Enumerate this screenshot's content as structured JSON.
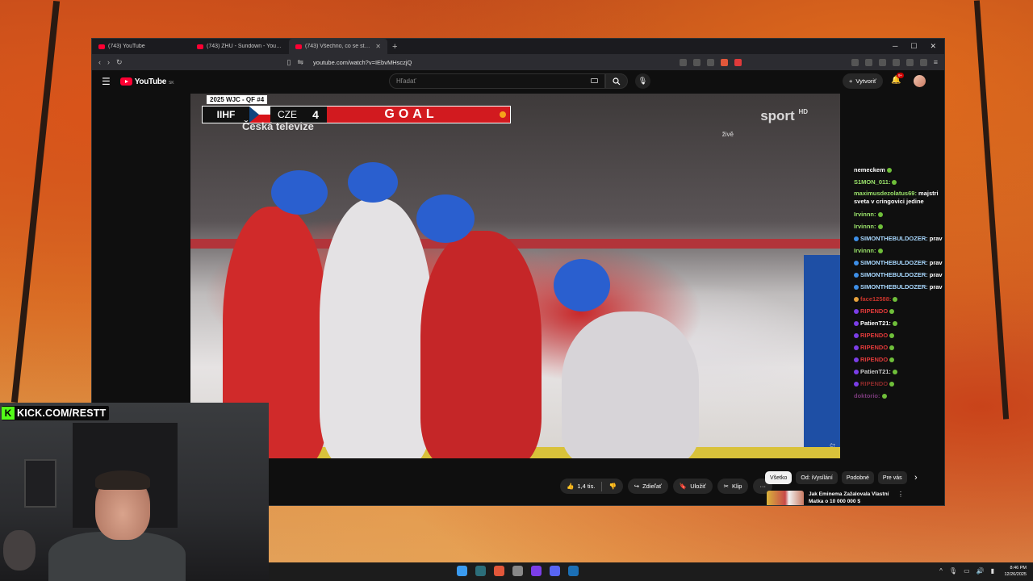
{
  "browser": {
    "tabs": [
      {
        "label": "(743) YouTube",
        "active": false
      },
      {
        "label": "(743) ZHU - Sundown - YouTube",
        "active": false
      },
      {
        "label": "(743) Všechno, co se stalo v …",
        "active": true
      }
    ],
    "new_tab": "+",
    "url": "youtube.com/watch?v=IEbvMHsczjQ"
  },
  "youtube": {
    "logo_text": "YouTube",
    "country": "SK",
    "search_placeholder": "Hľadať",
    "create_label": "Vytvoriť",
    "notification_count": "9+"
  },
  "video": {
    "tag": "2025 WJC - QF #4",
    "scorebug": {
      "league": "IIHF",
      "team": "CZE",
      "score": "4",
      "event": "GOAL"
    },
    "broadcaster_logo": "Česká televize",
    "channel_logo": "sport",
    "channel_hd": "HD",
    "live_label": "živě",
    "corner_logo": "ČT"
  },
  "chat": [
    {
      "user": "nemeckem",
      "color": "#ffffff",
      "badge": "",
      "msg": ""
    },
    {
      "user": "S1MON_011:",
      "color": "#9be36b",
      "badge": "",
      "msg": ""
    },
    {
      "user": "maximusdezolatus69:",
      "color": "#9be36b",
      "badge": "",
      "msg": "majstri sveta v cringovici jedine",
      "wrap": true
    },
    {
      "user": "Irvinnn:",
      "color": "#9be36b",
      "badge": "",
      "msg": ""
    },
    {
      "user": "Irvinnn:",
      "color": "#9be36b",
      "badge": "",
      "msg": ""
    },
    {
      "user": "SIMONTHEBULDOZER:",
      "color": "#a8d8ff",
      "badge": "#3d8fe8",
      "msg": "pravda"
    },
    {
      "user": "Irvinnn:",
      "color": "#9be36b",
      "badge": "",
      "msg": ""
    },
    {
      "user": "SIMONTHEBULDOZER:",
      "color": "#a8d8ff",
      "badge": "#3d8fe8",
      "msg": "pravda"
    },
    {
      "user": "SIMONTHEBULDOZER:",
      "color": "#a8d8ff",
      "badge": "#3d8fe8",
      "msg": "pravda"
    },
    {
      "user": "SIMONTHEBULDOZER:",
      "color": "#a8d8ff",
      "badge": "#3d8fe8",
      "msg": "pravda"
    },
    {
      "user": "face12588:",
      "color": "#c7342b",
      "badge": "#e8a33d",
      "msg": ""
    },
    {
      "user": "RIPENDO",
      "color": "#e23a3a",
      "badge": "#7b3ee8",
      "msg": ""
    },
    {
      "user": "PatienT21:",
      "color": "#ffffff",
      "badge": "#7b3ee8",
      "msg": ""
    },
    {
      "user": "RIPENDO",
      "color": "#e23a3a",
      "badge": "#7b3ee8",
      "msg": ""
    },
    {
      "user": "RIPENDO",
      "color": "#e23a3a",
      "badge": "#7b3ee8",
      "msg": ""
    },
    {
      "user": "RIPENDO",
      "color": "#e23a3a",
      "badge": "#7b3ee8",
      "msg": ""
    },
    {
      "user": "PatienT21:",
      "color": "#cccccc",
      "badge": "#7b3ee8",
      "msg": ""
    },
    {
      "user": "RIPENDO",
      "color": "#8a2a2a",
      "badge": "#7b3ee8",
      "msg": ""
    },
    {
      "user": "doktorio:",
      "color": "#7a3a7a",
      "badge": "",
      "msg": ""
    }
  ],
  "actions": {
    "like": "1,4 tis.",
    "share": "Zdieľať",
    "save": "Uložiť",
    "clip": "Klip",
    "more": "···"
  },
  "chips": [
    "Všetko",
    "Od: iVysílání",
    "Podobné",
    "Pre vás"
  ],
  "recommendation": {
    "title": "Jak Eminema Zažalovala Vlastní Matka o 10 000 000 $"
  },
  "stream": {
    "kick": "KICK.COM/RESTT"
  },
  "taskbar": {
    "time": "8:46 PM",
    "date": "12/26/2025"
  },
  "colors": {
    "yt_red": "#ff0033",
    "kick_green": "#53fc18",
    "goal_red": "#d21a1f"
  }
}
